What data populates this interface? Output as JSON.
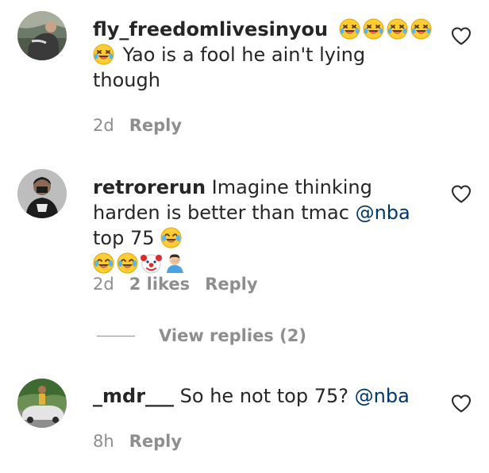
{
  "comments": [
    {
      "username": "fly_freedomlivesinyou",
      "text": "Yao is a fool he ain't lying though",
      "emojis_leading": [
        "rolling-on-floor-laughing",
        "rolling-on-floor-laughing",
        "rolling-on-floor-laughing",
        "rolling-on-floor-laughing",
        "rolling-on-floor-laughing"
      ],
      "time": "2d",
      "reply_label": "Reply"
    },
    {
      "username": "retrorerun",
      "text_before_mention": "Imagine thinking harden is better than tmac",
      "mention": "@nba",
      "text_after_mention": "top 75",
      "emojis_trailing": [
        "joy",
        "joy",
        "joy",
        "clown",
        "person-facepalming"
      ],
      "time": "2d",
      "likes": "2 likes",
      "reply_label": "Reply"
    },
    {
      "username": "_mdr___",
      "text_before_mention": "So he not top 75?",
      "mention": "@nba",
      "time": "8h",
      "reply_label": "Reply"
    }
  ],
  "view_replies": "View replies (2)",
  "colors": {
    "text": "#262626",
    "secondary": "#8e8e8e",
    "mention": "#00376b",
    "emoji_yellow": "#ffcc33"
  }
}
